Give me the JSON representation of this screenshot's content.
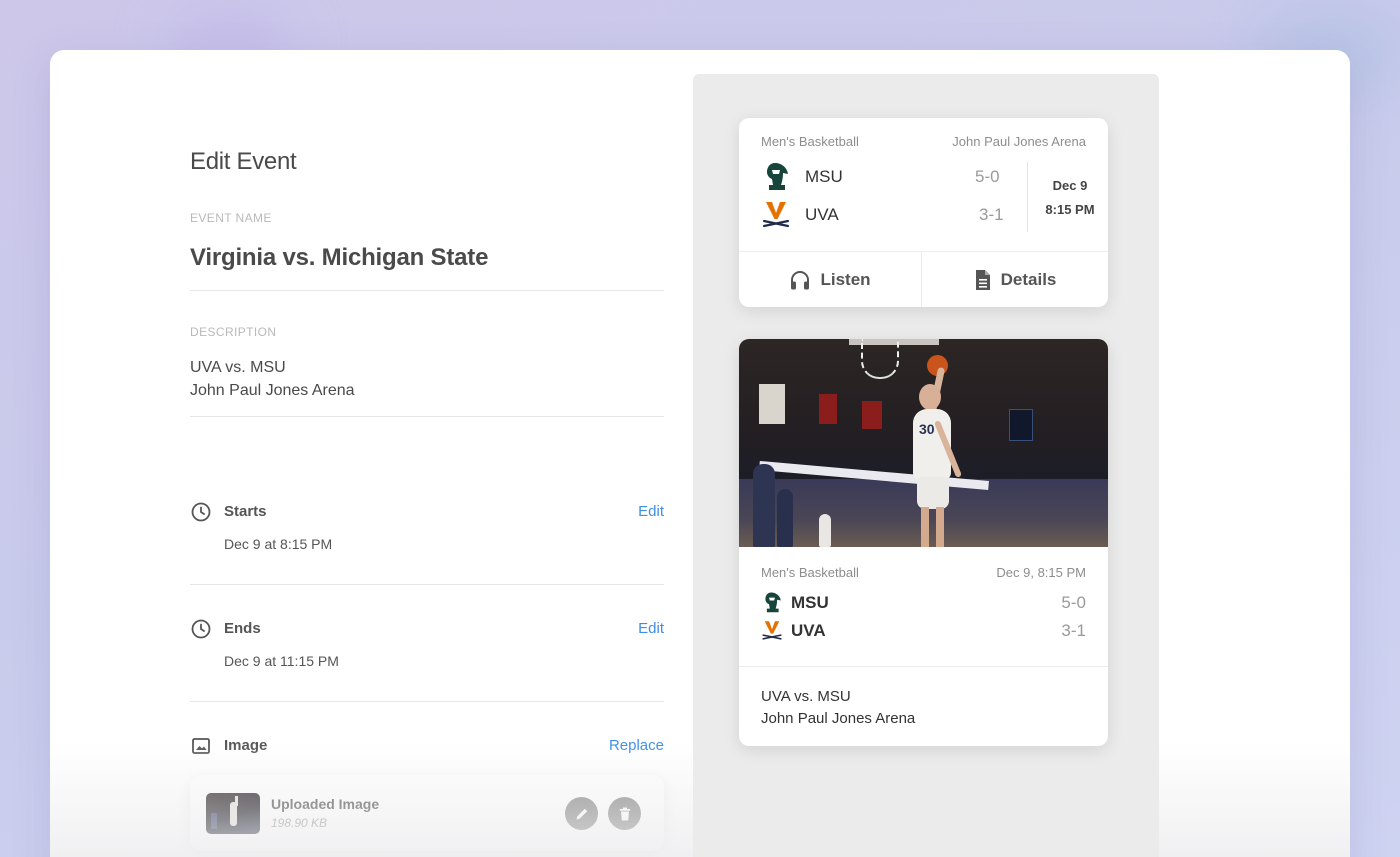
{
  "form": {
    "title": "Edit Event",
    "event_name_label": "EVENT NAME",
    "event_name": "Virginia vs. Michigan State",
    "description_label": "DESCRIPTION",
    "description_lines": [
      "UVA vs. MSU",
      "John Paul Jones Arena"
    ],
    "starts": {
      "label": "Starts",
      "value": "Dec 9 at 8:15 PM",
      "action": "Edit",
      "icon": "clock-icon"
    },
    "ends": {
      "label": "Ends",
      "value": "Dec 9 at 11:15 PM",
      "action": "Edit",
      "icon": "clock-icon"
    },
    "image": {
      "label": "Image",
      "action": "Replace",
      "icon": "image-icon"
    },
    "upload": {
      "name": "Uploaded Image",
      "size": "198.90 KB",
      "edit_icon": "pencil-icon",
      "delete_icon": "trash-icon"
    }
  },
  "preview": {
    "game_card": {
      "sport": "Men's Basketball",
      "venue": "John Paul Jones Arena",
      "teams": [
        {
          "name": "MSU",
          "record": "5-0",
          "logo": "msu-spartan-logo"
        },
        {
          "name": "UVA",
          "record": "3-1",
          "logo": "uva-cavalier-logo"
        }
      ],
      "date": "Dec 9",
      "time": "8:15 PM",
      "listen_label": "Listen",
      "details_label": "Details",
      "listen_icon": "headphones-icon",
      "details_icon": "document-icon"
    },
    "photo_card": {
      "sport": "Men's Basketball",
      "datetime": "Dec 9, 8:15 PM",
      "teams": [
        {
          "name": "MSU",
          "record": "5-0",
          "logo": "msu-spartan-logo"
        },
        {
          "name": "UVA",
          "record": "3-1",
          "logo": "uva-cavalier-logo"
        }
      ],
      "description_lines": [
        "UVA vs. MSU",
        "John Paul Jones Arena"
      ],
      "jersey_number": "30"
    }
  },
  "colors": {
    "link": "#3e8ee6",
    "msu_green": "#18453b",
    "uva_orange": "#e57200",
    "uva_navy": "#232d4b"
  }
}
